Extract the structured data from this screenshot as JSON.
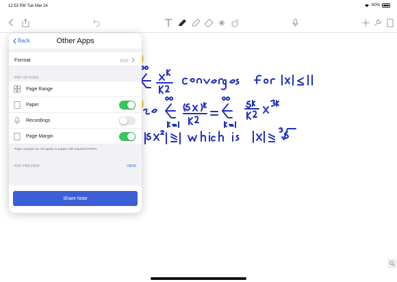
{
  "status_bar": {
    "time_date": "12:53 PM  Tue Mar 24",
    "battery": "90%"
  },
  "toolbar": {
    "icons": [
      "back-icon",
      "share-icon",
      "undo-icon",
      "text-tool-icon",
      "pen-icon",
      "highlighter-icon",
      "eraser-icon",
      "lasso-icon",
      "shapes-icon",
      "microphone-icon",
      "add-icon",
      "wrench-icon",
      "page-icon"
    ]
  },
  "popover": {
    "back_label": "Back",
    "title": "Other Apps",
    "format_label": "Format",
    "format_value": "PDF",
    "pdf_options_header": "PDF OPTIONS",
    "options": [
      {
        "label": "Page Range",
        "icon": "grid-icon",
        "toggle": null
      },
      {
        "label": "Paper",
        "icon": "page-icon",
        "toggle": true
      },
      {
        "label": "Recordings",
        "icon": "microphone-icon",
        "toggle": false
      },
      {
        "label": "Page Margin",
        "icon": "page-icon",
        "toggle": true
      }
    ],
    "margin_note": "Page margins do not apply to pages with imported PDFs.",
    "pdf_preview_header": "PDF PREVIEW",
    "view_label": "VIEW",
    "share_button": "Share Note"
  },
  "colors": {
    "accent": "#2f6fe0",
    "toggle_on": "#34c759",
    "ink": "#1f2fbf",
    "highlight": "#f4d03f",
    "share_button": "#3c5fd6"
  }
}
